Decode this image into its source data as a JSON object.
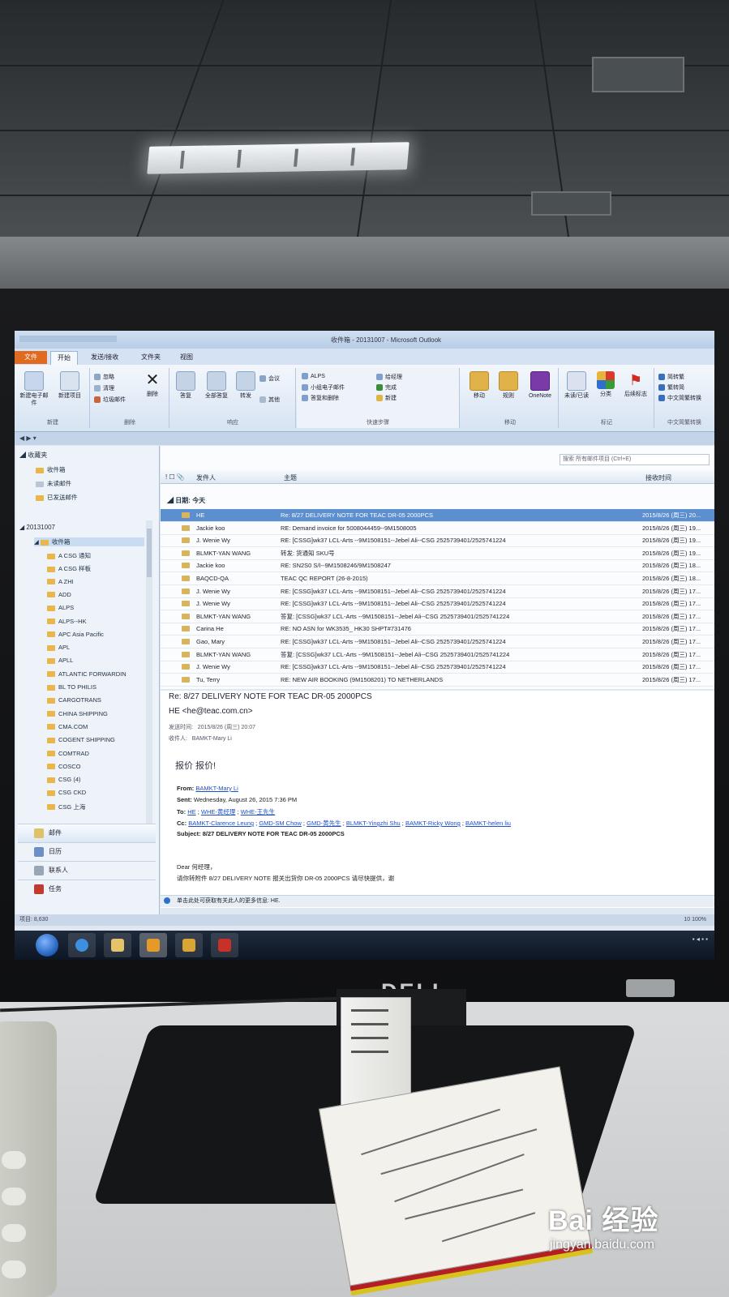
{
  "window": {
    "title": "收件箱 - 20131007 - Microsoft Outlook"
  },
  "ribbon": {
    "tabs": [
      "文件",
      "开始",
      "发送/接收",
      "文件夹",
      "视图"
    ],
    "active_tab": "开始",
    "new": {
      "new_mail": "新建电子邮件",
      "new_items": "新建项目",
      "group": "新建"
    },
    "delete": {
      "ignore": "忽略",
      "clean": "清理",
      "junk": "垃圾邮件",
      "delete": "删除",
      "group": "删除"
    },
    "respond": {
      "reply": "答复",
      "reply_all": "全部答复",
      "forward": "转发",
      "meeting": "会议",
      "more": "其他",
      "group": "响应"
    },
    "quick_steps": {
      "items": [
        "ALPS",
        "小组电子邮件",
        "答复和删除",
        "给经理",
        "完成",
        "新建"
      ],
      "group": "快速步骤"
    },
    "move": {
      "move": "移动",
      "rules": "规则",
      "onenote": "OneNote",
      "group": "移动"
    },
    "tags": {
      "unread": "未读/已读",
      "categorize": "分类",
      "followup": "后续标志",
      "group": "标记"
    },
    "chinese": {
      "items": [
        "简转繁",
        "繁转简",
        "中文简繁转换"
      ],
      "group": "中文简繁转换"
    }
  },
  "nav": {
    "favorites_header": "收藏夹",
    "favorites": [
      "收件箱",
      "未读邮件",
      "已发送邮件"
    ],
    "account": "20131007",
    "selected_folder": "收件箱",
    "folders": [
      "A CSG 通知",
      "A CSG 样板",
      "A ZHI",
      "ADD",
      "ALPS",
      "ALPS--HK",
      "APC Asia Pacific",
      "APL",
      "APLL",
      "ATLANTIC FORWARDIN",
      "BL TO PHILIS",
      "CARGOTRANS",
      "CHINA SHIPPING",
      "CMA.COM",
      "COGENT SHIPPING",
      "COMTRAD",
      "COSCO",
      "CSG (4)",
      "CSG CKD",
      "CSG 上海"
    ],
    "modules": [
      "邮件",
      "日历",
      "联系人",
      "任务"
    ]
  },
  "list": {
    "search_placeholder": "搜索 所有邮件项目 (Ctrl+E)",
    "columns": {
      "from": "发件人",
      "subject": "主题",
      "received": "接收时间"
    },
    "group_label": "日期: 今天",
    "rows": [
      {
        "from": "HE",
        "subject": "Re: 8/27 DELIVERY NOTE FOR TEAC  DR-05  2000PCS",
        "date": "2015/8/26 (周三) 20..."
      },
      {
        "from": "Jackie koo",
        "subject": "RE: Demand invoice for 5008044459--9M1508005",
        "date": "2015/8/26 (周三) 19..."
      },
      {
        "from": "J. Wenie Wy",
        "subject": "RE: [CSSG]wk37 LCL-Arts --9M1508151--Jebel Ali--CSG 2525739401/2525741224",
        "date": "2015/8/26 (周三) 19..."
      },
      {
        "from": "BLMKT-YAN WANG",
        "subject": "转发: 货通知 SKU号",
        "date": "2015/8/26 (周三) 19..."
      },
      {
        "from": "Jackie koo",
        "subject": "RE: SN2S0 S/I--9M1508246/9M1508247",
        "date": "2015/8/26 (周三) 18..."
      },
      {
        "from": "BAQCD-QA",
        "subject": "TEAC QC  REPORT   (26-8-2015)",
        "date": "2015/8/26 (周三) 18..."
      },
      {
        "from": "J. Wenie Wy",
        "subject": "RE: [CSSG]wk37 LCL-Arts --9M1508151--Jebel Ali--CSG 2525739401/2525741224",
        "date": "2015/8/26 (周三) 17..."
      },
      {
        "from": "J. Wenie Wy",
        "subject": "RE: [CSSG]wk37 LCL-Arts --9M1508151--Jebel Ali--CSG 2525739401/2525741224",
        "date": "2015/8/26 (周三) 17..."
      },
      {
        "from": "BLMKT-YAN WANG",
        "subject": "答复: [CSSG]wk37 LCL-Arts --9M1508151--Jebel Ali--CSG 2525739401/2525741224",
        "date": "2015/8/26 (周三) 17..."
      },
      {
        "from": "Carina He",
        "subject": "RE: NO ASN  for WK3535_ HK30 SHPT#731476",
        "date": "2015/8/26 (周三) 17..."
      },
      {
        "from": "Gao, Mary",
        "subject": "RE: [CSSG]wk37 LCL-Arts --9M1508151--Jebel Ali--CSG 2525739401/2525741224",
        "date": "2015/8/26 (周三) 17..."
      },
      {
        "from": "BLMKT-YAN WANG",
        "subject": "答复: [CSSG]wk37 LCL-Arts --9M1508151--Jebel Ali--CSG 2525739401/2525741224",
        "date": "2015/8/26 (周三) 17..."
      },
      {
        "from": "J. Wenie Wy",
        "subject": "RE: [CSSG]wk37 LCL-Arts --9M1508151--Jebel Ali--CSG 2525739401/2525741224",
        "date": "2015/8/26 (周三) 17..."
      },
      {
        "from": "Tu, Terry",
        "subject": "RE: NEW AIR BOOKING (9M1508201) TO NETHERLANDS",
        "date": "2015/8/26 (周三) 17..."
      }
    ]
  },
  "reading": {
    "subject": "Re: 8/27 DELIVERY NOTE FOR TEAC  DR-05  2000PCS",
    "sender": "HE <he@teac.com.cn>",
    "sent_label": "发送时间:",
    "sent_value": "2015/8/26 (周三) 20:07",
    "to_label": "收件人:",
    "to_value": "BAMKT-Mary Li",
    "big_line": "报价 报价!",
    "from_label": "From:",
    "from_value": "BAMKT-Mary Li",
    "sent2_label": "Sent:",
    "sent2_value": "Wednesday, August 26, 2015 7:36 PM",
    "to2_label": "To:",
    "to2_values": [
      "HE",
      "WHE-黄经理",
      "WHE-王先生"
    ],
    "cc_label": "Cc:",
    "cc_values": [
      "BAMKT-Clarence Leung",
      "GMD-SM Chow",
      "GMD-黄先生",
      "BLMKT-Yingzhi Shu",
      "BAMKT-Ricky Wong",
      "BAMKT-helen liu"
    ],
    "subject_label": "Subject:",
    "subject_value": "8/27 DELIVERY NOTE FOR TEAC DR-05 2000PCS",
    "greeting": "Dear 何经理，",
    "body": "请你转附件 8/27 DELIVERY NOTE 报关出货你 DR-05 2000PCS 请尽快提供，谢",
    "infobar": "单击此处可获取有关此人的更多信息: HE."
  },
  "status": {
    "left": "项目: 8,630",
    "zoom": "10   100%"
  },
  "photo": {
    "monitor_brand": "DELL",
    "watermark_main": "Bai 经验",
    "watermark_url": "jingyan.baidu.com"
  },
  "colors": {
    "accent": "#5b8fd0",
    "file_tab": "#e06a1e",
    "folder_icon": "#e8b64a"
  }
}
